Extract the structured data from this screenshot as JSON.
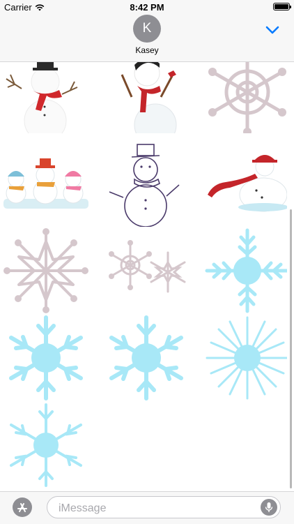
{
  "status_bar": {
    "carrier": "Carrier",
    "time": "8:42 PM",
    "battery_level": 1.0
  },
  "conversation": {
    "avatar_initial": "K",
    "contact_name": "Kasey"
  },
  "sticker_grid": {
    "stickers": [
      "snowman-with-red-scarf-sticker",
      "snowman-waving-red-scarf-sticker",
      "pink-wheel-snowflake-sticker",
      "three-snowmen-group-sticker",
      "sketched-snowman-top-hat-sticker",
      "snowman-red-hat-windy-scarf-sticker",
      "pink-star-snowflake-sticker",
      "two-pink-snowflakes-sticker",
      "blue-fern-snowflake-sticker",
      "blue-snowflake-sticker",
      "blue-snowflake-sticker",
      "blue-starburst-snowflake-sticker",
      "blue-snowflake-sticker"
    ]
  },
  "colors": {
    "snowflake_pink": "#d5c7cc",
    "snowflake_blue": "#a8e8f7",
    "scarf_red": "#d0282c",
    "ios_blue": "#007aff",
    "system_gray": "#8e8e93"
  },
  "input_bar": {
    "placeholder": "iMessage",
    "value": ""
  }
}
